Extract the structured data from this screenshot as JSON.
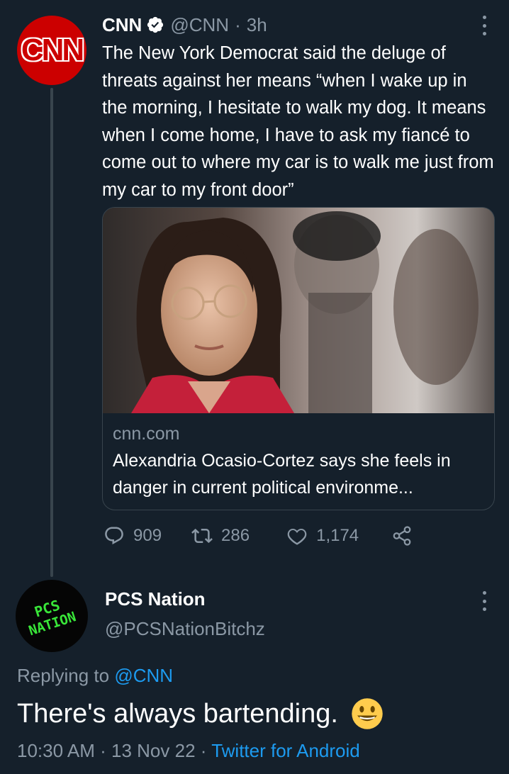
{
  "parent_tweet": {
    "author_name": "CNN",
    "handle": "@CNN",
    "separator": "·",
    "time_ago": "3h",
    "avatar_text": "CNN",
    "text": "The New York Democrat said the deluge of threats against her means “when I wake up in the morning, I hesitate to walk my dog. It means when I come home, I have to ask my fiancé to come out to where my car is to walk me just from my car to my front door”",
    "card": {
      "domain": "cnn.com",
      "title": "Alexandria Ocasio-Cortez says she feels in danger in current political environme..."
    },
    "actions": {
      "replies": "909",
      "retweets": "286",
      "likes": "1,174"
    }
  },
  "reply_tweet": {
    "author_name": "PCS Nation",
    "handle": "@PCSNationBitchz",
    "avatar_text_line1": "PCS",
    "avatar_text_line2": "NATION",
    "replying_label": "Replying to",
    "replying_mention": "@CNN",
    "text": "There's always bartending.",
    "time": "10:30 AM",
    "date": "13 Nov 22",
    "separator": "·",
    "source": "Twitter for Android"
  },
  "colors": {
    "background": "#15202b",
    "secondary_text": "#8b98a5",
    "accent": "#1d9bf0",
    "border": "#38444d",
    "cnn_red": "#cc0000",
    "pcs_green": "#39e639"
  },
  "icons": [
    "verified-badge-icon",
    "more-icon",
    "reply-icon",
    "retweet-icon",
    "like-icon",
    "share-icon",
    "grinning-face-emoji"
  ]
}
